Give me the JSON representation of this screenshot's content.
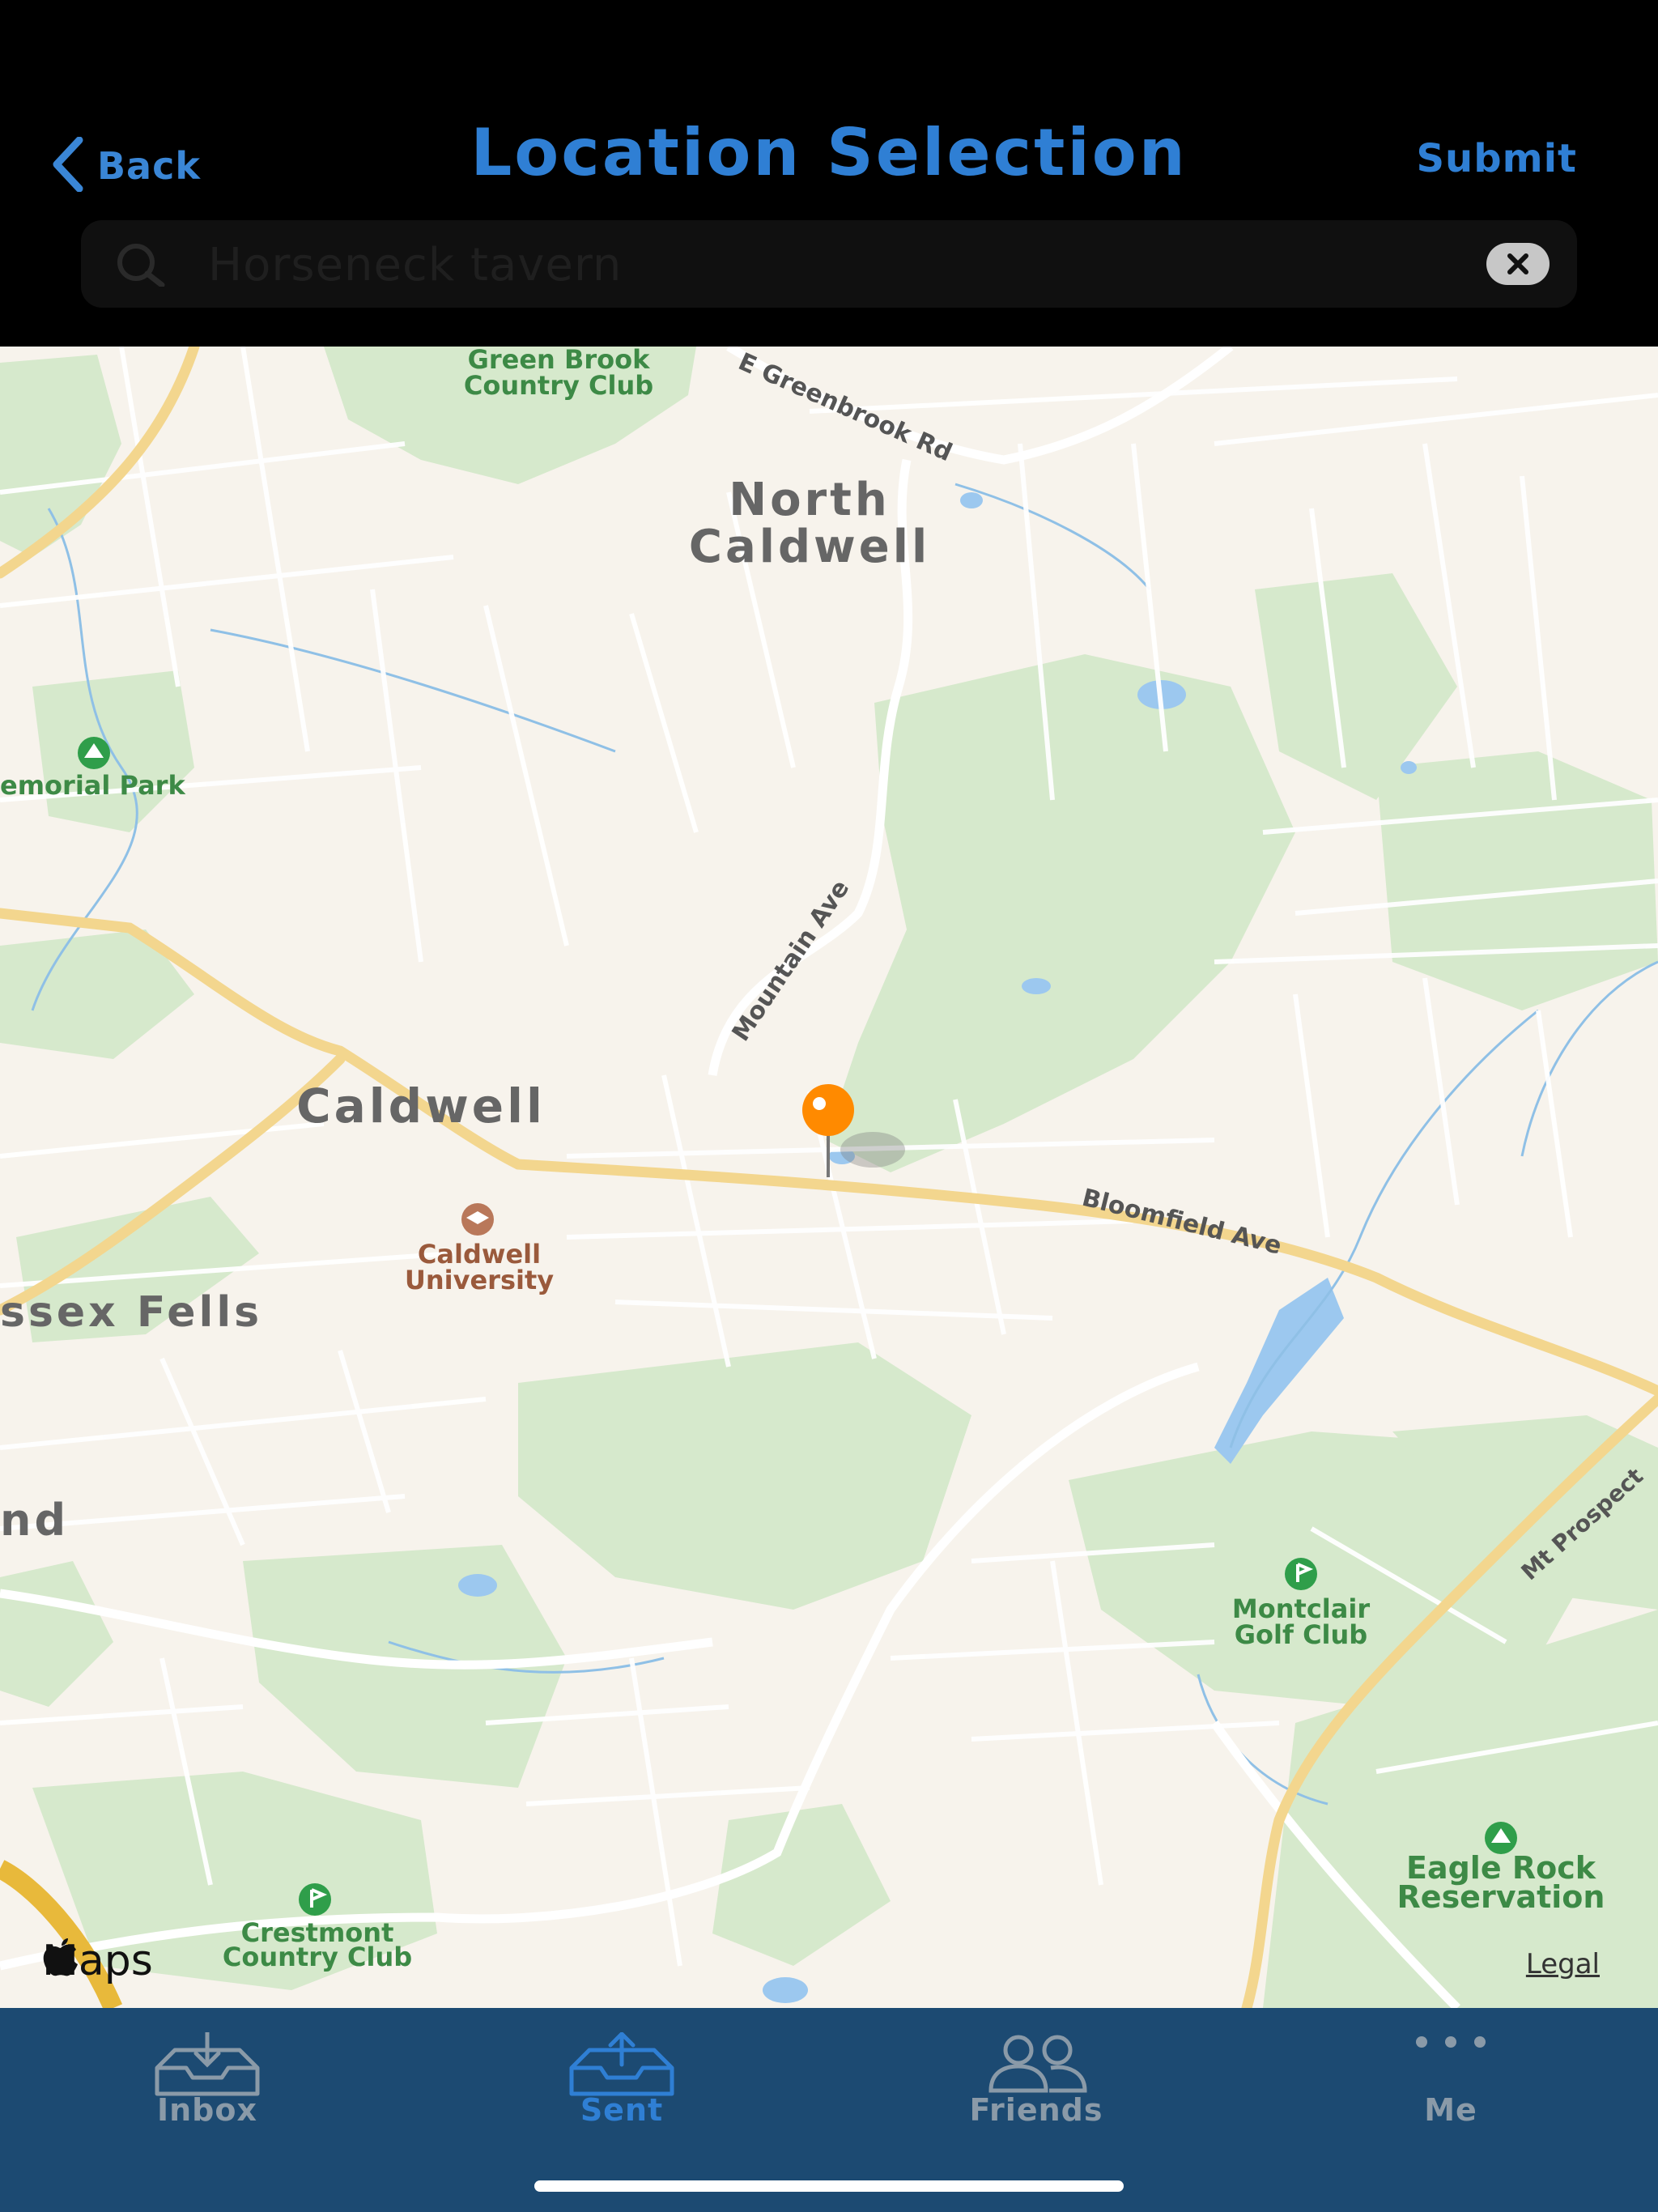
{
  "header": {
    "back_label": "Back",
    "title": "Location Selection",
    "submit_label": "Submit",
    "back_icon": "chevron-left-icon",
    "accent_color": "#2f7fd4"
  },
  "search": {
    "value": "Horseneck tavern",
    "icon": "search-icon",
    "clear_icon": "clear-icon"
  },
  "map": {
    "labels": {
      "green_brook_1": "Green Brook",
      "green_brook_2": "Country Club",
      "e_greenbrook": "E Greenbrook Rd",
      "north_caldwell_1": "North",
      "north_caldwell_2": "Caldwell",
      "memorial_park": "emorial Park",
      "mountain_ave": "Mountain Ave",
      "caldwell": "Caldwell",
      "bloomfield_ave": "Bloomfield Ave",
      "caldwell_university_1": "Caldwell",
      "caldwell_university_2": "University",
      "essex_fells": "ssex Fells",
      "partial_nd": "nd",
      "montclair_1": "Montclair",
      "montclair_2": "Golf Club",
      "mt_prospect": "Mt Prospect",
      "eagle_rock_1": "Eagle Rock",
      "eagle_rock_2": "Reservation",
      "crestmont_1": "Crestmont",
      "crestmont_2": "Country Club"
    },
    "pin_color": "#ff8a00",
    "attribution": "Maps",
    "legal": "Legal"
  },
  "tabs": [
    {
      "label": "Inbox",
      "icon": "inbox-icon",
      "active": false
    },
    {
      "label": "Sent",
      "icon": "sent-icon",
      "active": true
    },
    {
      "label": "Friends",
      "icon": "friends-icon",
      "active": false
    },
    {
      "label": "Me",
      "icon": "more-icon",
      "active": false
    }
  ]
}
